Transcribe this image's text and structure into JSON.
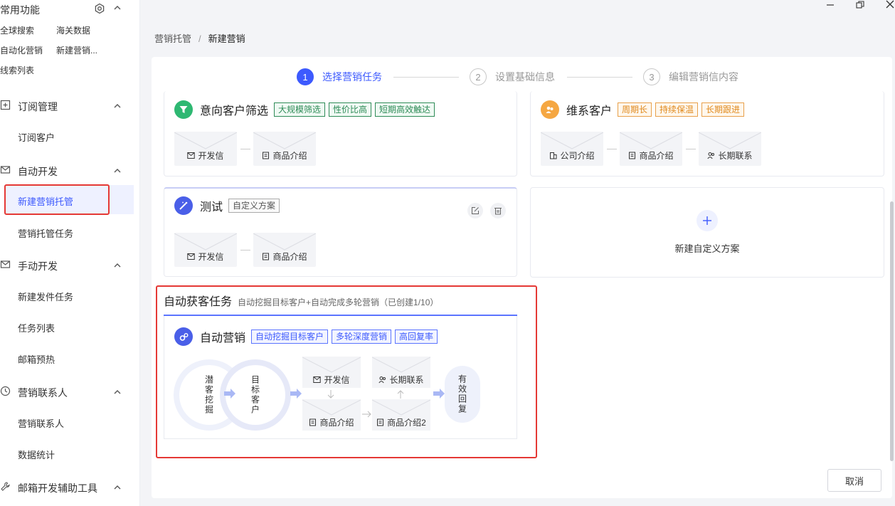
{
  "sidebar": {
    "quick": {
      "title": "常用功能",
      "links": [
        "全球搜索",
        "海关数据",
        "自动化营销",
        "新建营销...",
        "线索列表"
      ]
    },
    "sections": [
      {
        "title": "订阅管理",
        "items": [
          "订阅客户"
        ]
      },
      {
        "title": "自动开发",
        "items": [
          "新建营销托管",
          "营销托管任务"
        ]
      },
      {
        "title": "手动开发",
        "items": [
          "新建发件任务",
          "任务列表",
          "邮箱预热"
        ]
      },
      {
        "title": "营销联系人",
        "items": [
          "营销联系人",
          "数据统计"
        ]
      },
      {
        "title": "邮箱开发辅助工具",
        "items": []
      }
    ],
    "active_item": "新建营销托管"
  },
  "breadcrumb": {
    "parent": "营销托管",
    "separator": "/",
    "current": "新建营销"
  },
  "steps": [
    {
      "num": "1",
      "label": "选择营销任务",
      "active": true
    },
    {
      "num": "2",
      "label": "设置基础信息",
      "active": false
    },
    {
      "num": "3",
      "label": "编辑营销信内容",
      "active": false
    }
  ],
  "cards": {
    "intent": {
      "title": "意向客户筛选",
      "tags": [
        "大规模筛选",
        "性价比高",
        "短期高效触达"
      ],
      "envelopes": [
        "开发信",
        "商品介绍"
      ]
    },
    "maintain": {
      "title": "维系客户",
      "tags": [
        "周期长",
        "持续保温",
        "长期跟进"
      ],
      "envelopes": [
        "公司介绍",
        "商品介绍",
        "长期联系"
      ]
    },
    "test": {
      "title": "测试",
      "tags": [
        "自定义方案"
      ],
      "envelopes": [
        "开发信",
        "商品介绍"
      ]
    },
    "add_custom": {
      "label": "新建自定义方案"
    }
  },
  "auto": {
    "section_title": "自动获客任务",
    "section_subtitle": "自动挖掘目标客户+自动完成多轮营销（已创建1/10）",
    "card_title": "自动营销",
    "tags": [
      "自动挖掘目标客户",
      "多轮深度营销",
      "高回复率"
    ],
    "flow": {
      "stage1": "潜客挖掘",
      "stage2": "目标客户",
      "env_top1": "开发信",
      "env_top2": "长期联系",
      "env_bottom1": "商品介绍",
      "env_bottom2": "商品介绍2",
      "result": "有效回复"
    }
  },
  "buttons": {
    "cancel": "取消"
  },
  "colors": {
    "accent": "#3d5afe",
    "highlight_box": "#e53935",
    "tag_green": "#2e8b57",
    "tag_orange": "#e08a1e"
  }
}
